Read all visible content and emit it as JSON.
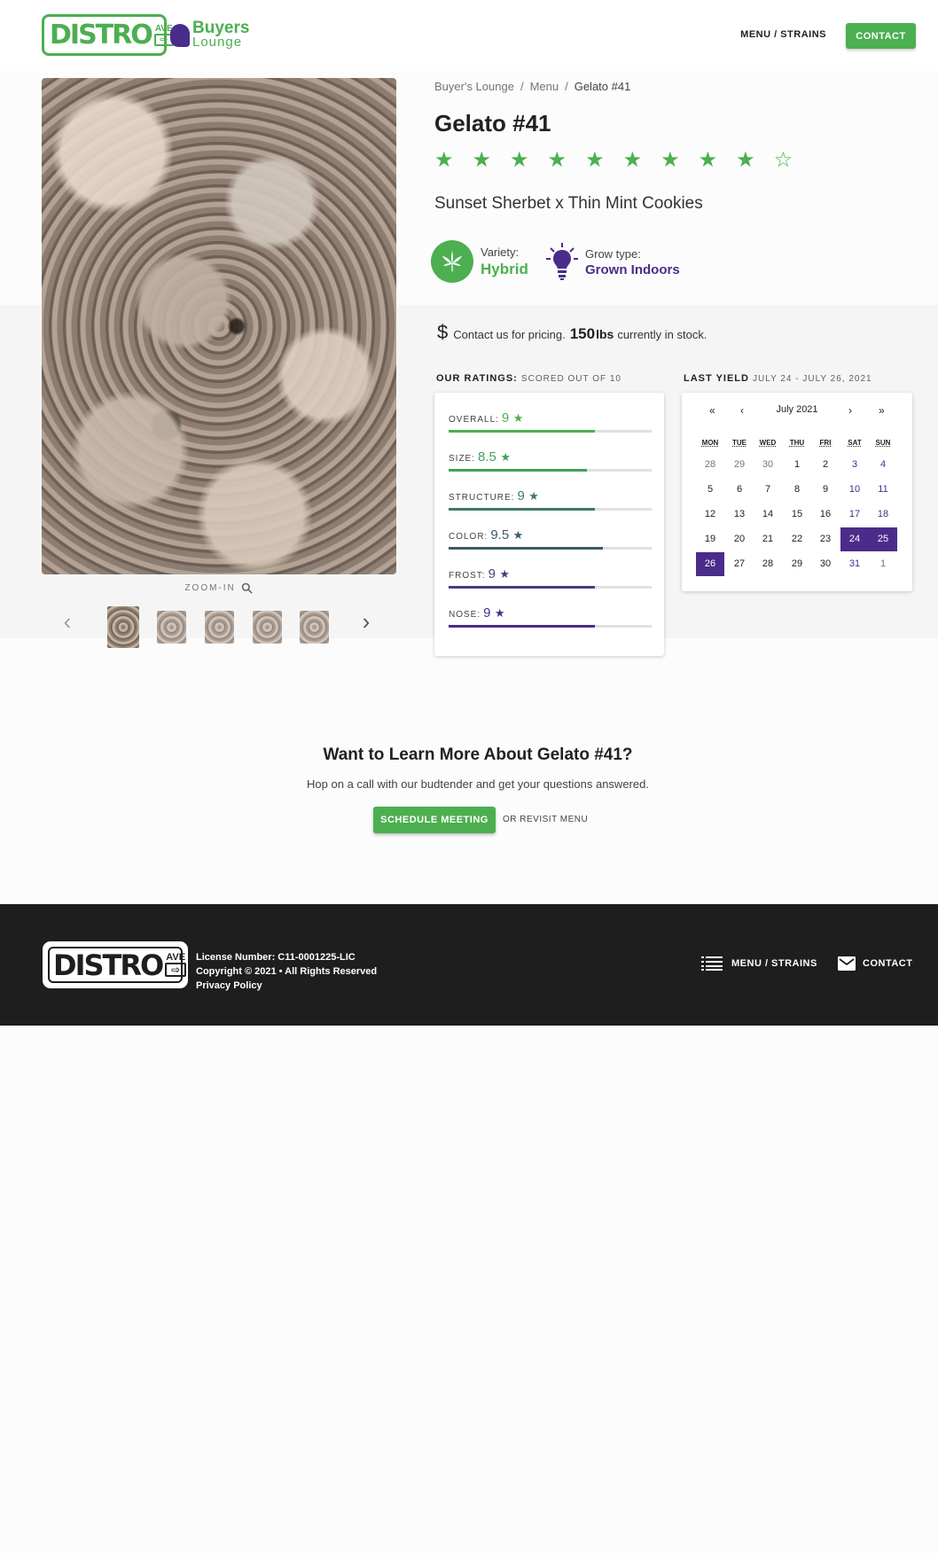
{
  "header": {
    "logo_text": "DISTRO",
    "logo_ave": "AVE",
    "lounge_line1": "Buyers",
    "lounge_line2": "Lounge",
    "nav_menu": "MENU / STRAINS",
    "nav_contact": "CONTACT"
  },
  "gallery": {
    "zoom_label": "ZOOM-IN",
    "thumbnail_count": 5,
    "active_thumbnail": 1
  },
  "breadcrumb": {
    "items": [
      "Buyer's Lounge",
      "/",
      "Menu",
      "/",
      "Gelato #41"
    ]
  },
  "product": {
    "name": "Gelato #41",
    "rating_stars": 9,
    "rating_max": 10,
    "lineage": "Sunset Sherbet x Thin Mint Cookies",
    "variety_label": "Variety:",
    "variety_value": "Hybrid",
    "grow_label": "Grow type:",
    "grow_value": "Grown Indoors",
    "pricing_text": "Contact us for pricing.",
    "stock_qty": "150",
    "stock_unit": "lbs",
    "stock_text": "currently in stock."
  },
  "ratings": {
    "heading": "OUR RATINGS:",
    "subheading": "SCORED OUT OF 10",
    "items": [
      {
        "label": "OVERALL:",
        "value": "9",
        "score": 9,
        "color": "#4caf50"
      },
      {
        "label": "SIZE:",
        "value": "8.5",
        "score": 8.5,
        "color": "#43a05a"
      },
      {
        "label": "STRUCTURE:",
        "value": "9",
        "score": 9,
        "color": "#3f7a63"
      },
      {
        "label": "COLOR:",
        "value": "9.5",
        "score": 9.5,
        "color": "#3d5a6c"
      },
      {
        "label": "FROST:",
        "value": "9",
        "score": 9,
        "color": "#4a3c82"
      },
      {
        "label": "NOSE:",
        "value": "9",
        "score": 9,
        "color": "#4a2c8a"
      }
    ]
  },
  "yield": {
    "heading": "LAST YIELD",
    "range": "JULY 24 - JULY 26, 2021",
    "month": "July 2021",
    "nav": [
      "«",
      "‹",
      "›",
      "»"
    ],
    "dow": [
      "MON",
      "TUE",
      "WED",
      "THU",
      "FRI",
      "SAT",
      "SUN"
    ],
    "weeks": [
      [
        "28",
        "29",
        "30",
        "1",
        "2",
        "3",
        "4"
      ],
      [
        "5",
        "6",
        "7",
        "8",
        "9",
        "10",
        "11"
      ],
      [
        "12",
        "13",
        "14",
        "15",
        "16",
        "17",
        "18"
      ],
      [
        "19",
        "20",
        "21",
        "22",
        "23",
        "24",
        "25"
      ],
      [
        "26",
        "27",
        "28",
        "29",
        "30",
        "31",
        "1"
      ]
    ],
    "accent": "#4a2c8a"
  },
  "cta": {
    "title": "Want to Learn More About Gelato #41?",
    "subtitle": "Hop on a call with our budtender and get your questions answered.",
    "button": "SCHEDULE MEETING",
    "link": "OR REVISIT MENU"
  },
  "footer": {
    "license": "License Number: C11-0001225-LIC",
    "copyright": "Copyright © 2021 • All Rights Reserved",
    "privacy": "Privacy Policy",
    "menu": "MENU / STRAINS",
    "contact": "CONTACT"
  },
  "colors": {
    "brand_green": "#4caf50",
    "brand_purple": "#4a2c8a",
    "footer_bg": "#1e1e1e"
  }
}
